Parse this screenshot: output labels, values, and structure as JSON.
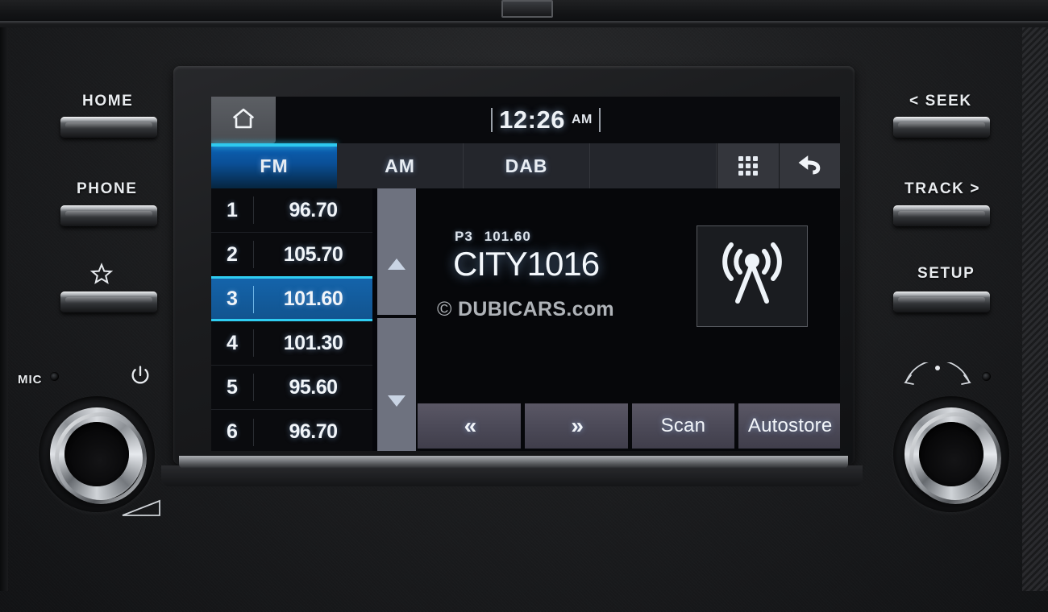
{
  "device": {
    "type": "car-infotainment-head-unit",
    "left_buttons": [
      {
        "label": "HOME",
        "name": "home"
      },
      {
        "label": "PHONE",
        "name": "phone"
      },
      {
        "label": "",
        "name": "favorite-star",
        "icon": "star-icon"
      }
    ],
    "right_buttons": [
      {
        "label": "< SEEK",
        "name": "seek"
      },
      {
        "label": "TRACK >",
        "name": "track"
      },
      {
        "label": "SETUP",
        "name": "setup"
      }
    ],
    "mic_label": "MIC",
    "power_icon": "power-icon",
    "volume_icon": "volume-triangle-icon",
    "tune_icon": "rotary-arc-arrows-icon"
  },
  "screen": {
    "status": {
      "home_icon": "home-icon",
      "time": "12:26",
      "ampm": "AM"
    },
    "tabs": [
      {
        "label": "FM",
        "active": true
      },
      {
        "label": "AM",
        "active": false
      },
      {
        "label": "DAB",
        "active": false
      },
      {
        "label": "",
        "active": false
      }
    ],
    "tab_icons": [
      {
        "name": "grid-icon"
      },
      {
        "name": "back-arrow-icon",
        "glyph": "↩"
      }
    ],
    "presets": [
      {
        "num": "1",
        "freq": "96.70",
        "selected": false
      },
      {
        "num": "2",
        "freq": "105.70",
        "selected": false
      },
      {
        "num": "3",
        "freq": "101.60",
        "selected": true
      },
      {
        "num": "4",
        "freq": "101.30",
        "selected": false
      },
      {
        "num": "5",
        "freq": "95.60",
        "selected": false
      },
      {
        "num": "6",
        "freq": "96.70",
        "selected": false
      }
    ],
    "scrollbar": {
      "up_icon": "triangle-up-icon",
      "down_icon": "triangle-down-icon"
    },
    "now_playing": {
      "preset": "P3",
      "frequency": "101.60",
      "station_name": "CITY1016",
      "logo_icon": "radio-antenna-icon"
    },
    "watermark": {
      "copyright": "©",
      "text": "DUBICARS.com"
    },
    "bottom_buttons": [
      {
        "label": "«",
        "name": "prev-seek-button",
        "is_chevron": true
      },
      {
        "label": "»",
        "name": "next-seek-button",
        "is_chevron": true
      },
      {
        "label": "Scan",
        "name": "scan-button",
        "is_chevron": false
      },
      {
        "label": "Autostore",
        "name": "autostore-button",
        "is_chevron": false
      }
    ]
  },
  "colors": {
    "accent_cyan": "#2fcdf2",
    "active_blue": "#0d63b8",
    "selected_row": "#1464ab",
    "screen_bg": "#06070a",
    "text": "#f1f5f9"
  }
}
